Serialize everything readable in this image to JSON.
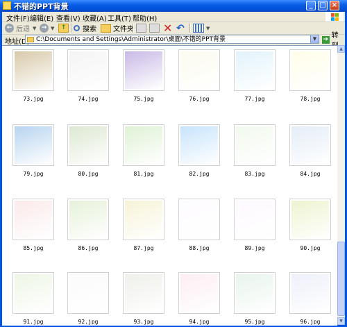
{
  "window": {
    "title": "不错的PPT背景"
  },
  "menu": [
    "文件(F)",
    "编辑(E)",
    "查看(V)",
    "收藏(A)",
    "工具(T)",
    "帮助(H)"
  ],
  "toolbar": {
    "back": "后退",
    "search": "搜索",
    "folders": "文件夹"
  },
  "address": {
    "label": "地址(D)",
    "path": "C:\\Documents and Settings\\Administrator\\桌面\\不错的PPT背景",
    "go": "转到"
  },
  "files": [
    {
      "name": "73.jpg",
      "bg": "#d8c9a8"
    },
    {
      "name": "74.jpg",
      "bg": "#f4f4f4"
    },
    {
      "name": "75.jpg",
      "bg": "#c9b9e6"
    },
    {
      "name": "76.jpg",
      "bg": "#fbfbef"
    },
    {
      "name": "77.jpg",
      "bg": "#e2f3fb"
    },
    {
      "name": "78.jpg",
      "bg": "#fffde8"
    },
    {
      "name": "79.jpg",
      "bg": "#b7d4ef"
    },
    {
      "name": "80.jpg",
      "bg": "#dde8d2"
    },
    {
      "name": "81.jpg",
      "bg": "#dff2d5"
    },
    {
      "name": "82.jpg",
      "bg": "#c7e4fb"
    },
    {
      "name": "83.jpg",
      "bg": "#f2f9ee"
    },
    {
      "name": "84.jpg",
      "bg": "#e4edf7"
    },
    {
      "name": "85.jpg",
      "bg": "#fbe9ea"
    },
    {
      "name": "86.jpg",
      "bg": "#e6f1d9"
    },
    {
      "name": "87.jpg",
      "bg": "#f7f3d6"
    },
    {
      "name": "88.jpg",
      "bg": "#fdfbff"
    },
    {
      "name": "89.jpg",
      "bg": "#fdf9ff"
    },
    {
      "name": "90.jpg",
      "bg": "#eef3cf"
    },
    {
      "name": "91.jpg",
      "bg": "#eef6e6"
    },
    {
      "name": "92.jpg",
      "bg": "#fbfbfb"
    },
    {
      "name": "93.jpg",
      "bg": "#eef0ea"
    },
    {
      "name": "94.jpg",
      "bg": "#fdeef3"
    },
    {
      "name": "95.jpg",
      "bg": "#e8f4ec"
    },
    {
      "name": "96.jpg",
      "bg": "#eef0fa"
    }
  ]
}
